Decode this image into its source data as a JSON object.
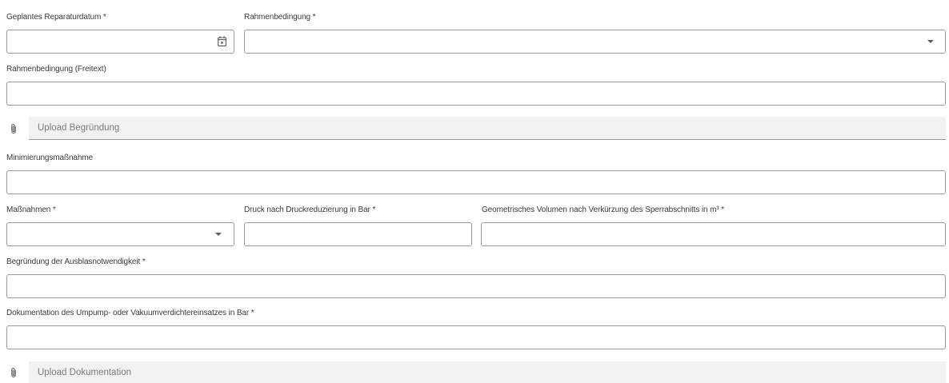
{
  "row1": {
    "repair_date": {
      "label": "Geplantes Reparaturdatum *",
      "value": "",
      "icon": "calendar-icon"
    },
    "framework": {
      "label": "Rahmenbedingung *",
      "value": "",
      "icon": "chevron-down-icon"
    }
  },
  "framework_text": {
    "label": "Rahmenbedingung (Freitext)",
    "value": ""
  },
  "upload_reason": {
    "label": "Upload Begründung",
    "icon": "paperclip-icon"
  },
  "minimization": {
    "label": "Minimierungsmaßnahme",
    "value": ""
  },
  "row_measures": {
    "measures": {
      "label": "Maßnahmen *",
      "value": "",
      "icon": "chevron-down-icon"
    },
    "pressure": {
      "label": "Druck nach Druckreduzierung in Bar *",
      "value": ""
    },
    "volume": {
      "label": "Geometrisches Volumen nach Verkürzung des Sperrabschnitts in m³ *",
      "value": ""
    }
  },
  "blowout_reason": {
    "label": "Begründung der Ausblasnotwendigkeit *",
    "value": ""
  },
  "pump_doc": {
    "label": "Dokumentation des Umpump- oder Vakuumverdichtereinsatzes in Bar *",
    "value": ""
  },
  "upload_doc": {
    "label": "Upload Dokumentation",
    "icon": "paperclip-icon"
  },
  "colors": {
    "border": "#9a9a9a",
    "upload_bg": "#f2f2f2",
    "label_text": "#3a3a3a",
    "placeholder_text": "#7b7b7b"
  }
}
